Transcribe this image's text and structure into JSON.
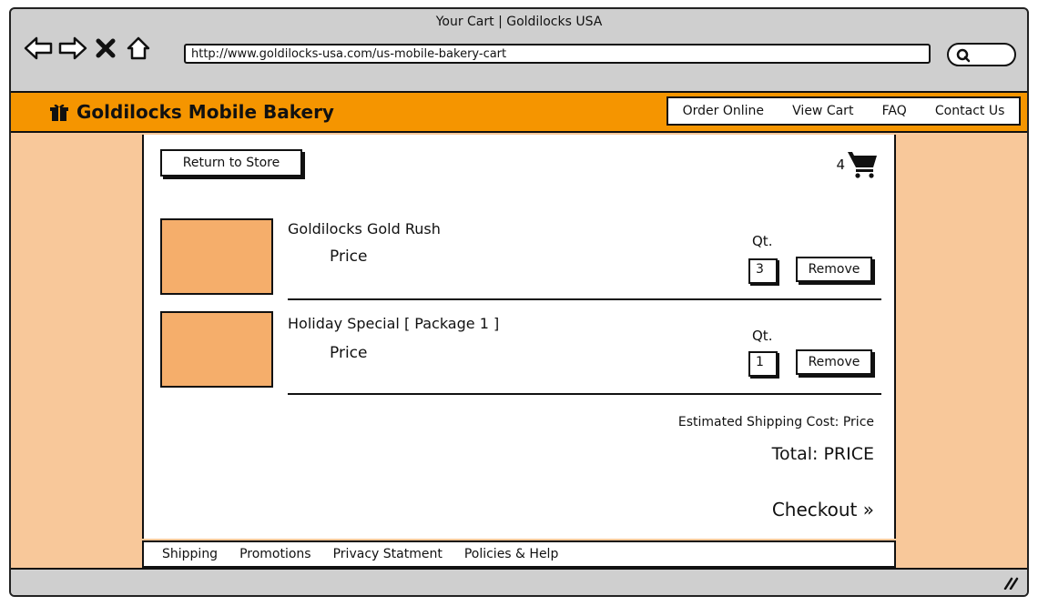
{
  "window": {
    "title": "Your Cart | Goldilocks USA",
    "url": "http://www.goldilocks-usa.com/us-mobile-bakery-cart"
  },
  "header": {
    "brand": "Goldilocks Mobile Bakery",
    "nav": [
      "Order Online",
      "View Cart",
      "FAQ",
      "Contact Us"
    ]
  },
  "cart": {
    "return_label": "Return to Store",
    "count": "4",
    "qty_label": "Qt.",
    "remove_label": "Remove",
    "items": [
      {
        "name": "Goldilocks Gold Rush",
        "price": "Price",
        "qty": "3"
      },
      {
        "name": "Holiday Special [ Package 1 ]",
        "price": "Price",
        "qty": "1"
      }
    ],
    "shipping": "Estimated Shipping Cost: Price",
    "total": "Total: PRICE",
    "checkout": "Checkout »"
  },
  "footer": {
    "links": [
      "Shipping",
      "Promotions",
      "Privacy Statment",
      "Policies & Help"
    ]
  },
  "colors": {
    "accent": "#f59500",
    "page_bg": "#f8c89a",
    "thumb": "#f5ae6b",
    "chrome": "#cfcfcf"
  }
}
